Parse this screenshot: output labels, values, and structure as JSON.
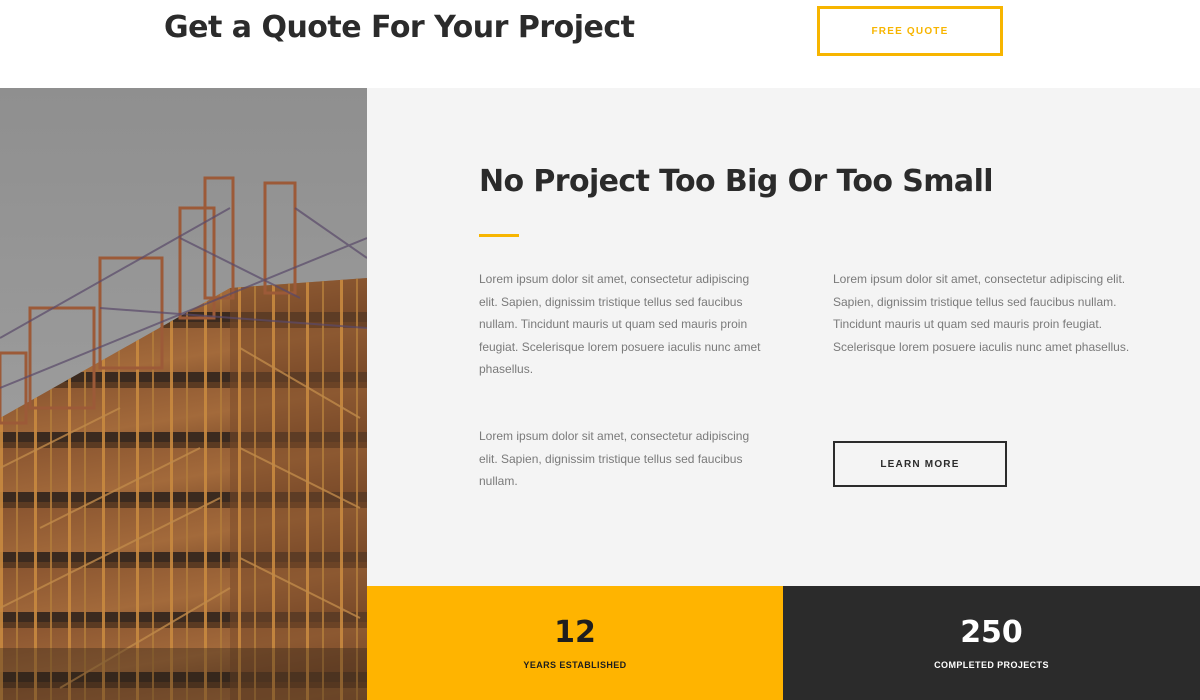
{
  "quote_section": {
    "headline": "Get a Quote For Your Project",
    "button_label": "FREE QUOTE"
  },
  "about": {
    "title": "No Project Too Big Or Too Small",
    "paragraph_1": "Lorem ipsum dolor sit amet, consectetur adipiscing elit. Sapien, dignissim tristique tellus sed faucibus nullam. Tincidunt mauris ut quam sed mauris proin feugiat. Scelerisque lorem posuere iaculis nunc amet phasellus.",
    "paragraph_2": "Lorem ipsum dolor sit amet, consectetur adipiscing elit. Sapien, dignissim tristique tellus sed faucibus nullam.",
    "paragraph_3": "Lorem ipsum dolor sit amet, consectetur adipiscing elit. Sapien, dignissim tristique tellus sed faucibus nullam. Tincidunt mauris ut quam sed mauris proin feugiat. Scelerisque lorem posuere iaculis nunc amet phasellus.",
    "button_label": "LEARN MORE"
  },
  "stats": [
    {
      "number": "12",
      "label": "YEARS ESTABLISHED"
    },
    {
      "number": "250",
      "label": "COMPLETED PROJECTS"
    }
  ],
  "colors": {
    "accent": "#ffb400",
    "dark": "#2b2b2b",
    "panel_bg": "#f4f4f4",
    "body_text": "#7a7a7a"
  },
  "image": {
    "subject": "construction-scaffolding-photo"
  }
}
